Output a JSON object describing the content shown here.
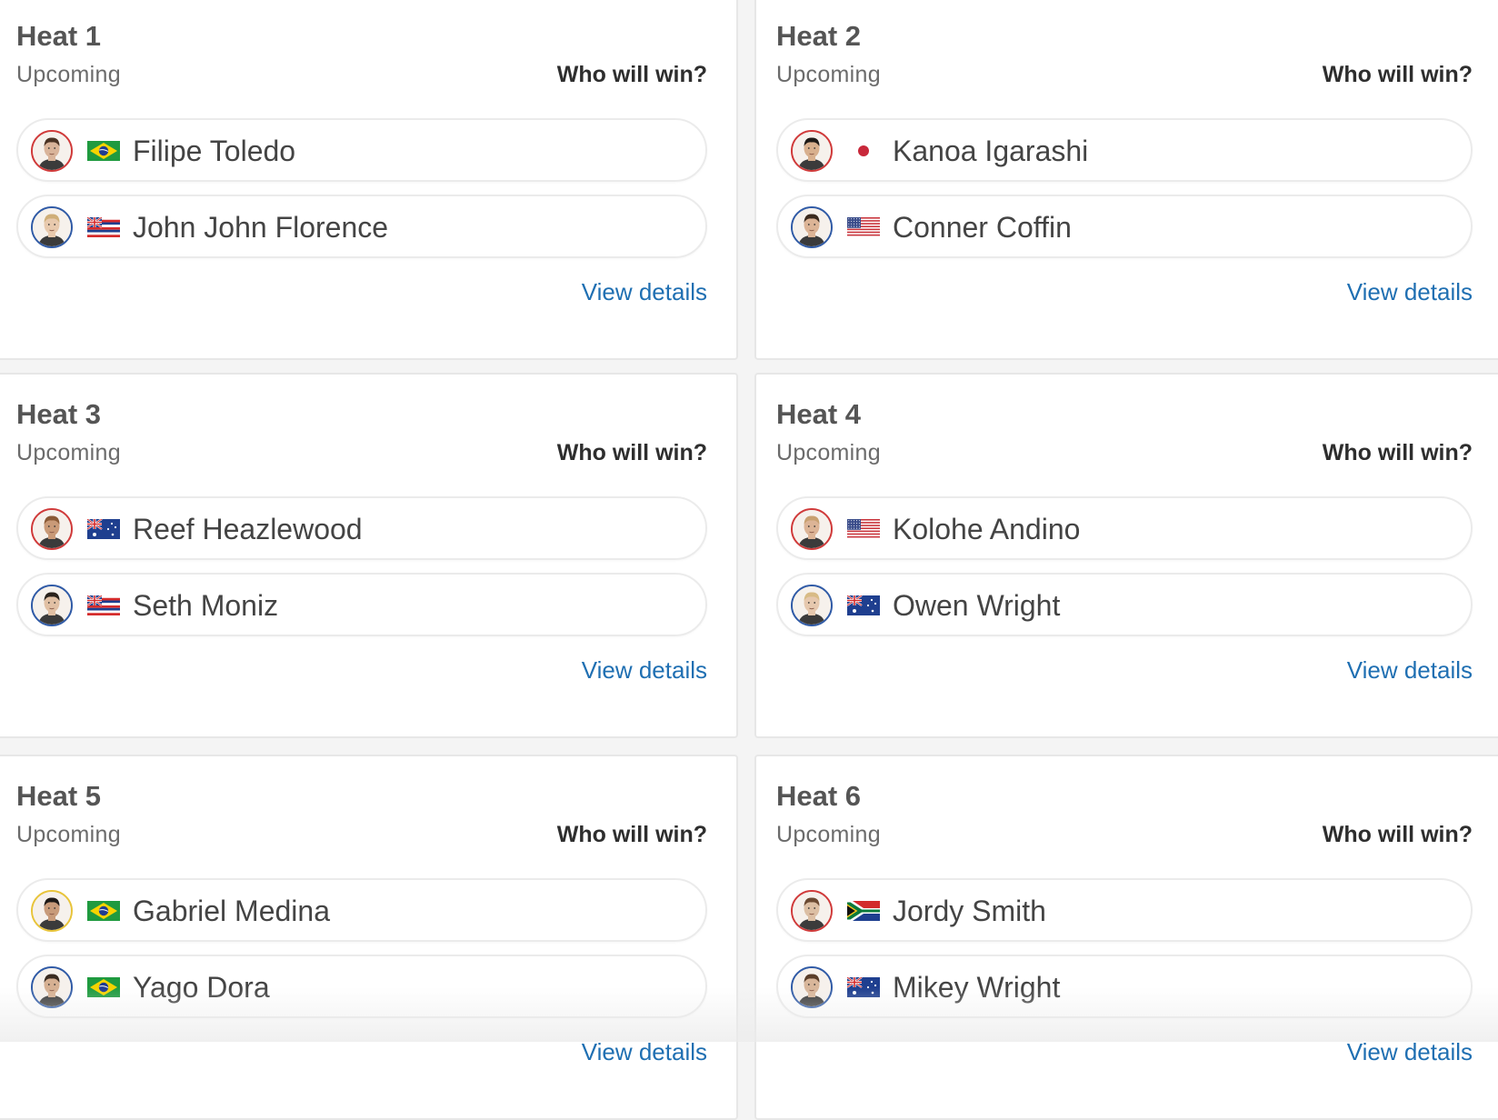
{
  "heats": [
    {
      "title": "Heat 1",
      "status": "Upcoming",
      "prompt": "Who will win?",
      "link": "View details",
      "surfers": [
        {
          "name": "Filipe Toledo",
          "flag": "brazil",
          "ring": "#d03a3a",
          "skin": "#d9b49a",
          "hair": "#4a3324"
        },
        {
          "name": "John John Florence",
          "flag": "hawaii",
          "ring": "#2f5aa6",
          "skin": "#e8c9ad",
          "hair": "#cfae78"
        }
      ]
    },
    {
      "title": "Heat 2",
      "status": "Upcoming",
      "prompt": "Who will win?",
      "link": "View details",
      "surfers": [
        {
          "name": "Kanoa Igarashi",
          "flag": "japan",
          "ring": "#d03a3a",
          "skin": "#d8b08e",
          "hair": "#1e1a17"
        },
        {
          "name": "Conner Coffin",
          "flag": "usa",
          "ring": "#2f5aa6",
          "skin": "#dcb496",
          "hair": "#3b2a1e"
        }
      ]
    },
    {
      "title": "Heat 3",
      "status": "Upcoming",
      "prompt": "Who will win?",
      "link": "View details",
      "surfers": [
        {
          "name": "Reef Heazlewood",
          "flag": "australia",
          "ring": "#d03a3a",
          "skin": "#c99a78",
          "hair": "#8a5a36"
        },
        {
          "name": "Seth Moniz",
          "flag": "hawaii",
          "ring": "#2f5aa6",
          "skin": "#e1c0a4",
          "hair": "#2a221c"
        }
      ]
    },
    {
      "title": "Heat 4",
      "status": "Upcoming",
      "prompt": "Who will win?",
      "link": "View details",
      "surfers": [
        {
          "name": "Kolohe Andino",
          "flag": "usa",
          "ring": "#d03a3a",
          "skin": "#dcb496",
          "hair": "#c8a070"
        },
        {
          "name": "Owen Wright",
          "flag": "australia",
          "ring": "#2f5aa6",
          "skin": "#e6c8ae",
          "hair": "#d8bb86"
        }
      ]
    },
    {
      "title": "Heat 5",
      "status": "Upcoming",
      "prompt": "Who will win?",
      "link": "View details",
      "surfers": [
        {
          "name": "Gabriel Medina",
          "flag": "brazil",
          "ring": "#e8c43a",
          "skin": "#c89b7a",
          "hair": "#1e1a17"
        },
        {
          "name": "Yago Dora",
          "flag": "brazil",
          "ring": "#2f5aa6",
          "skin": "#d6b092",
          "hair": "#3a2b20"
        }
      ]
    },
    {
      "title": "Heat 6",
      "status": "Upcoming",
      "prompt": "Who will win?",
      "link": "View details",
      "surfers": [
        {
          "name": "Jordy Smith",
          "flag": "south-africa",
          "ring": "#d03a3a",
          "skin": "#dcbfa4",
          "hair": "#6b4a32"
        },
        {
          "name": "Mikey Wright",
          "flag": "australia",
          "ring": "#2f5aa6",
          "skin": "#d8b69a",
          "hair": "#5a3e2a"
        }
      ]
    }
  ],
  "colors": {
    "link": "#1f6fb2",
    "card_border": "#e7e7e7",
    "background": "#f4f4f4"
  }
}
